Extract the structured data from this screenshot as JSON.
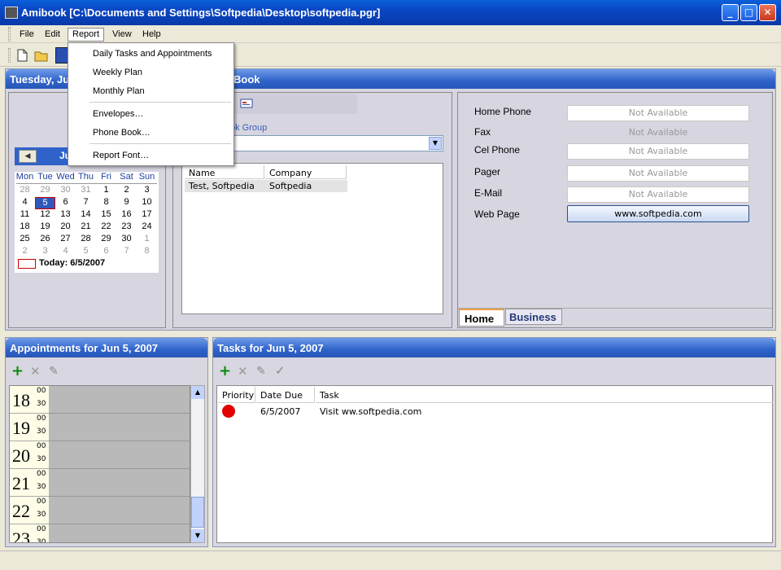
{
  "window": {
    "title": "Amibook [C:\\Documents and Settings\\Softpedia\\Desktop\\softpedia.pgr]",
    "minimize": "_",
    "maximize": "□",
    "close": "✕"
  },
  "menu": [
    "File",
    "Edit",
    "Report",
    "View",
    "Help"
  ],
  "report_menu": {
    "items": [
      "Daily Tasks and Appointments",
      "Weekly Plan",
      "Monthly Plan",
      "Envelopes…",
      "Phone Book…",
      "Report Font…"
    ]
  },
  "date_header": {
    "left": "Tuesday, Ju",
    "right": "Book"
  },
  "calendar": {
    "nav_prev": "◀",
    "month_label": "Ju",
    "weekdays": [
      "Mon",
      "Tue",
      "Wed",
      "Thu",
      "Fri",
      "Sat",
      "Sun"
    ],
    "weeks": [
      [
        "28",
        "29",
        "30",
        "31",
        "1",
        "2",
        "3"
      ],
      [
        "4",
        "5",
        "6",
        "7",
        "8",
        "9",
        "10"
      ],
      [
        "11",
        "12",
        "13",
        "14",
        "15",
        "16",
        "17"
      ],
      [
        "18",
        "19",
        "20",
        "21",
        "22",
        "23",
        "24"
      ],
      [
        "25",
        "26",
        "27",
        "28",
        "29",
        "30",
        "1"
      ],
      [
        "2",
        "3",
        "4",
        "5",
        "6",
        "7",
        "8"
      ]
    ],
    "today": "Today: 6/5/2007",
    "selected": "5"
  },
  "phonebook": {
    "group_label": "ok Group",
    "columns": [
      "Name",
      "Company"
    ],
    "rows": [
      [
        "Test, Softpedia",
        "Softpedia"
      ]
    ]
  },
  "contact": {
    "fields": [
      {
        "label": "Home Phone",
        "value": "Not Available"
      },
      {
        "label": "Fax",
        "value": "Not Available"
      },
      {
        "label": "Cel Phone",
        "value": "Not Available"
      },
      {
        "label": "Pager",
        "value": "Not Available"
      },
      {
        "label": "E-Mail",
        "value": "Not Available"
      }
    ],
    "web_label": "Web Page",
    "web_value": "www.softpedia.com",
    "tabs": [
      "Home",
      "Business"
    ]
  },
  "appointments": {
    "title": "Appointments for Jun 5, 2007",
    "hours": [
      "18",
      "19",
      "20",
      "21",
      "22",
      "23"
    ],
    "mins": [
      "00",
      "30"
    ]
  },
  "tasks": {
    "title": "Tasks for Jun 5, 2007",
    "columns": [
      "Priority",
      "Date Due",
      "Task"
    ],
    "rows": [
      {
        "due": "6/5/2007",
        "task": "Visit ww.softpedia.com"
      }
    ]
  },
  "colors": {
    "priority_high": "#e00000",
    "accent": "#2f63c9"
  }
}
